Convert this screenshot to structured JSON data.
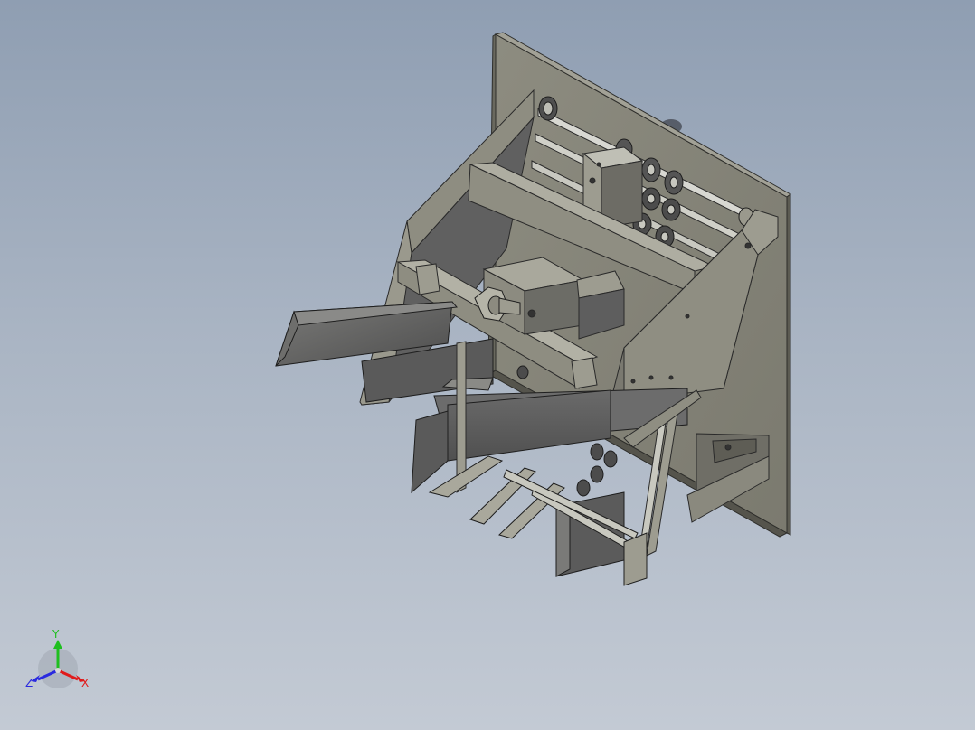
{
  "window": {
    "title": ""
  },
  "view": {
    "orientation": "isometric",
    "display_mode": "shaded-with-edges"
  },
  "model": {
    "description_name": "feeder-mechanism-assembly",
    "colors": {
      "background_top": "#8f9eb2",
      "background_bottom": "#c3cad4",
      "plate_face": "#86857a",
      "plate_edge": "#5f5e55",
      "frame_light": "#9d9c90",
      "frame_dark": "#6d6c65",
      "part_dark": "#5c5c5c",
      "edge": "#2a2a2a"
    }
  },
  "triad": {
    "y_label": "Y",
    "x_label": "X",
    "z_label": "Z",
    "y_color": "#1fbf1f",
    "x_color": "#e01a1a",
    "z_color": "#2a2adf"
  }
}
